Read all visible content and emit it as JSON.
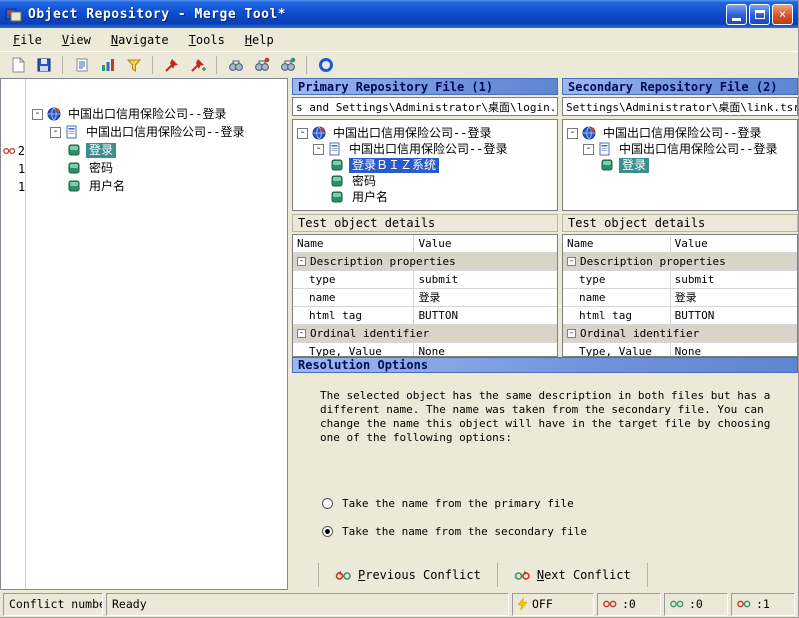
{
  "window": {
    "title": "Object Repository - Merge Tool*"
  },
  "menu": {
    "items": [
      {
        "label": "File"
      },
      {
        "label": "View"
      },
      {
        "label": "Navigate"
      },
      {
        "label": "Tools"
      },
      {
        "label": "Help"
      }
    ]
  },
  "toolbar": {
    "icons": [
      "new-icon",
      "save-icon",
      "report-icon",
      "statistics-icon",
      "filter-icon",
      "locate-primary-icon",
      "locate-secondary-icon",
      "find-icon",
      "find-primary-icon",
      "find-secondary-icon",
      "zoom-icon"
    ]
  },
  "left_tree": {
    "conflicts": [
      {
        "count": "2"
      },
      {
        "count": "1"
      },
      {
        "count": "1"
      }
    ],
    "rows": [
      {
        "label": "中国出口信用保险公司--登录"
      },
      {
        "label": "中国出口信用保险公司--登录"
      },
      {
        "label": "登录",
        "selected": true
      },
      {
        "label": "密码"
      },
      {
        "label": "用户名"
      }
    ]
  },
  "primary": {
    "header": "Primary Repository File (1)",
    "path": "s and Settings\\Administrator\\桌面\\login.tsr",
    "tree": [
      {
        "label": "中国出口信用保险公司--登录"
      },
      {
        "label": "中国出口信用保险公司--登录"
      },
      {
        "label": "登录ＢＩＺ系统",
        "selected": true
      },
      {
        "label": "密码"
      },
      {
        "label": "用户名"
      }
    ],
    "details_title": "Test object details",
    "table": {
      "columns": [
        "Name",
        "Value"
      ],
      "rows": [
        {
          "kind": "section",
          "name": "Description properties",
          "value": ""
        },
        {
          "kind": "data",
          "name": "type",
          "value": "submit"
        },
        {
          "kind": "data",
          "name": "name",
          "value": "登录"
        },
        {
          "kind": "data",
          "name": "html tag",
          "value": "BUTTON"
        },
        {
          "kind": "section",
          "name": "Ordinal identifier",
          "value": ""
        },
        {
          "kind": "data",
          "name": "Type, Value",
          "value": "None"
        }
      ]
    }
  },
  "secondary": {
    "header": "Secondary Repository File (2)",
    "path": "Settings\\Administrator\\桌面\\link.tsr",
    "tree": [
      {
        "label": "中国出口信用保险公司--登录"
      },
      {
        "label": "中国出口信用保险公司--登录"
      },
      {
        "label": "登录",
        "selected": true
      }
    ],
    "details_title": "Test object details",
    "table": {
      "columns": [
        "Name",
        "Value"
      ],
      "rows": [
        {
          "kind": "section",
          "name": "Description properties",
          "value": ""
        },
        {
          "kind": "data",
          "name": "type",
          "value": "submit"
        },
        {
          "kind": "data",
          "name": "name",
          "value": "登录"
        },
        {
          "kind": "data",
          "name": "html tag",
          "value": "BUTTON"
        },
        {
          "kind": "section",
          "name": "Ordinal identifier",
          "value": ""
        },
        {
          "kind": "data",
          "name": "Type, Value",
          "value": "None"
        }
      ]
    }
  },
  "resolution": {
    "header": "Resolution Options",
    "text": "The selected object has the same description in both files but has a different name. The name was taken from the secondary file. You can change the name this object will have in the target file by choosing one of the following options:",
    "options": [
      {
        "label": "Take the name from the primary file",
        "selected": false
      },
      {
        "label": "Take the name from the secondary file",
        "selected": true
      }
    ]
  },
  "nav": {
    "previous": "Previous Conflict",
    "next": "Next Conflict"
  },
  "statusbar": {
    "conflict_label": "Conflict number",
    "status": "Ready",
    "keyboard": "OFF",
    "counters": [
      {
        "value": ":0"
      },
      {
        "value": ":0"
      },
      {
        "value": ":1"
      }
    ],
    "colors": {
      "header_blue": "#6e93da",
      "selection_blue": "#2A5BC8",
      "selection_teal": "#3D8F8F"
    }
  }
}
